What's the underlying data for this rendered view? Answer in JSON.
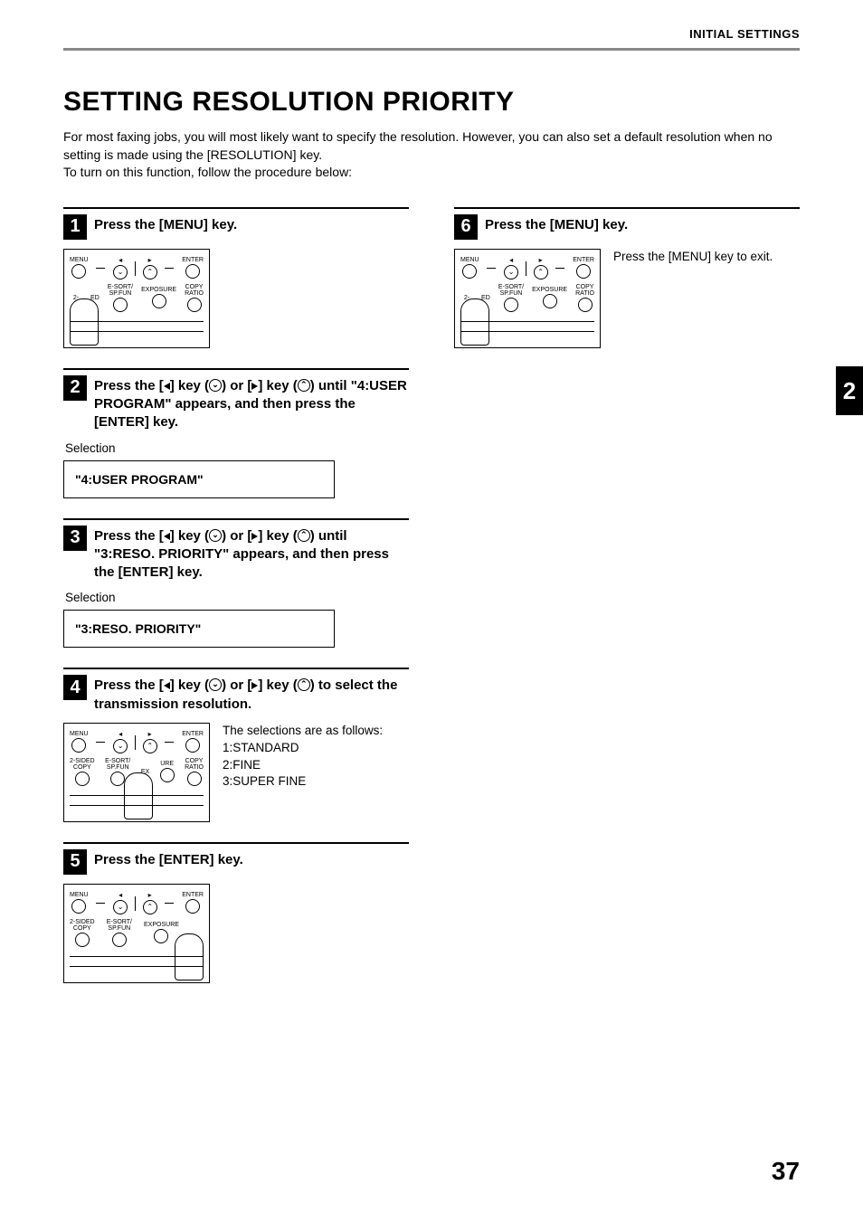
{
  "header": {
    "label": "INITIAL SETTINGS"
  },
  "title": "SETTING RESOLUTION PRIORITY",
  "intro": "For most faxing jobs, you will most likely want to specify the resolution. However, you can also set a default resolution when no setting is made using the [RESOLUTION] key.\nTo turn on this function, follow the procedure below:",
  "side_tab": "2",
  "page_number": "37",
  "panel_labels": {
    "menu": "MENU",
    "enter": "ENTER",
    "two_sided": "2-SIDED\nCOPY",
    "ed": "ED",
    "esort": "E-SORT/\nSP.FUN",
    "exposure": "EXPOSURE",
    "copy_ratio": "COPY\nRATIO",
    "ure": "URE"
  },
  "steps": {
    "s1": {
      "num": "1",
      "title": "Press the [MENU] key."
    },
    "s2": {
      "num": "2",
      "title_pre": "Press the [",
      "title_mid1": "] key (",
      "title_mid2": ") or [",
      "title_mid3": "] key (",
      "title_post": ") until \"4:USER PROGRAM\" appears, and then press the [ENTER] key.",
      "selection_label": "Selection",
      "display": "\"4:USER PROGRAM\""
    },
    "s3": {
      "num": "3",
      "title_pre": "Press the [",
      "title_mid1": "] key (",
      "title_mid2": ") or [",
      "title_mid3": "] key (",
      "title_post": ") until \"3:RESO. PRIORITY\" appears, and then press the [ENTER] key.",
      "selection_label": "Selection",
      "display": "\"3:RESO. PRIORITY\""
    },
    "s4": {
      "num": "4",
      "title_pre": "Press the [",
      "title_mid1": "] key (",
      "title_mid2": ") or [",
      "title_mid3": "] key (",
      "title_post": ") to select the transmission resolution.",
      "body": "The selections are as follows:\n1:STANDARD\n2:FINE\n3:SUPER FINE"
    },
    "s5": {
      "num": "5",
      "title": "Press the [ENTER] key."
    },
    "s6": {
      "num": "6",
      "title": "Press the [MENU] key.",
      "body": "Press the [MENU] key to exit."
    }
  }
}
